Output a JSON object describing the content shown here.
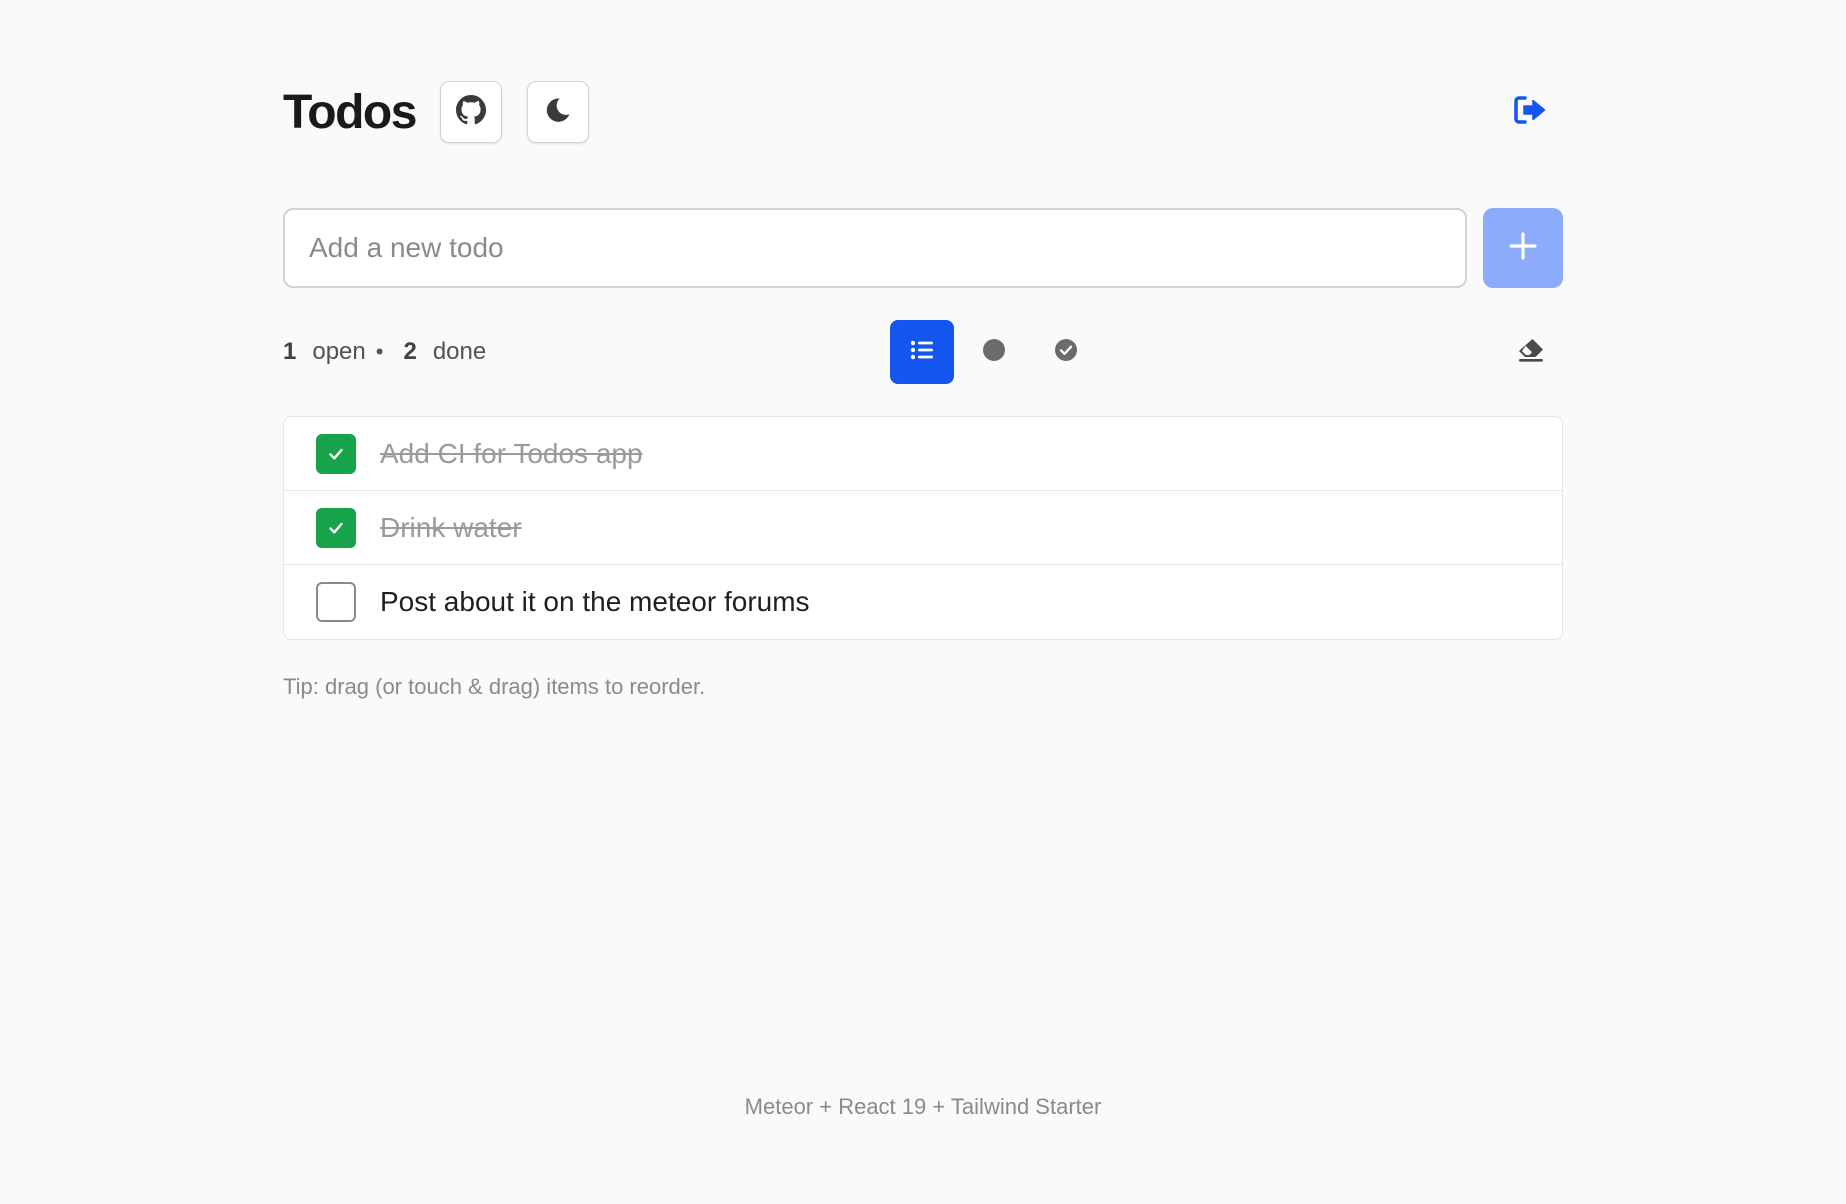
{
  "header": {
    "title": "Todos",
    "github_icon": "github-icon",
    "theme_icon": "moon-icon",
    "logout_icon": "sign-out-icon"
  },
  "add": {
    "placeholder": "Add a new todo",
    "value": "",
    "button_icon": "plus-icon"
  },
  "stats": {
    "open_count": "1",
    "open_label": "open",
    "separator": "•",
    "done_count": "2",
    "done_label": "done"
  },
  "filters": [
    {
      "name": "all",
      "icon": "list-icon",
      "active": true
    },
    {
      "name": "open",
      "icon": "circle-icon",
      "active": false
    },
    {
      "name": "done",
      "icon": "check-circle-icon",
      "active": false
    }
  ],
  "clear_icon": "eraser-icon",
  "todos": [
    {
      "text": "Add CI for Todos app",
      "done": true
    },
    {
      "text": "Drink water",
      "done": true
    },
    {
      "text": "Post about it on the meteor forums",
      "done": false
    }
  ],
  "tip": "Tip: drag (or touch & drag) items to reorder.",
  "footer": "Meteor + React 19 + Tailwind Starter",
  "colors": {
    "accent": "#1456f0",
    "add_button": "#8cabfb",
    "checked": "#16a34a",
    "background": "#fafafa"
  }
}
